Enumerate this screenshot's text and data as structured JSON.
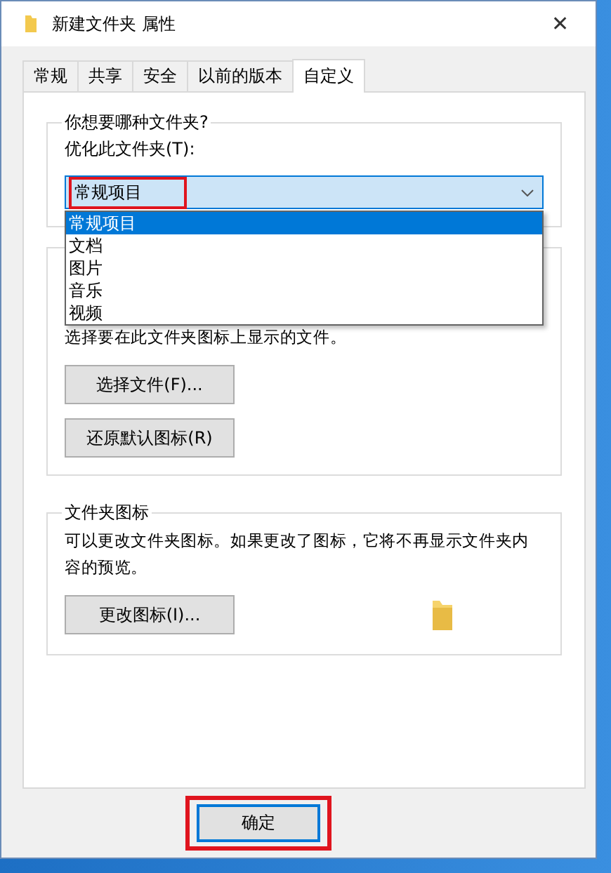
{
  "window": {
    "title": "新建文件夹 属性",
    "close": "✕"
  },
  "tabs": [
    {
      "label": "常规",
      "selected": false
    },
    {
      "label": "共享",
      "selected": false
    },
    {
      "label": "安全",
      "selected": false
    },
    {
      "label": "以前的版本",
      "selected": false
    },
    {
      "label": "自定义",
      "selected": true
    }
  ],
  "folder_type": {
    "title": "你想要哪种文件夹?",
    "label": "优化此文件夹(T):",
    "value": "常规项目",
    "highlighted": true,
    "expanded": true,
    "options": [
      {
        "label": "常规项目",
        "selected": true
      },
      {
        "label": "文档",
        "selected": false
      },
      {
        "label": "图片",
        "selected": false
      },
      {
        "label": "音乐",
        "selected": false
      },
      {
        "label": "视频",
        "selected": false
      }
    ]
  },
  "folder_pictures": {
    "description": "选择要在此文件夹图标上显示的文件。",
    "buttons": [
      "选择文件(F)...",
      "还原默认图标(R)"
    ]
  },
  "folder_icons": {
    "title": "文件夹图标",
    "description": "可以更改文件夹图标。如果更改了图标，它将不再显示文件夹内容的预览。",
    "button": "更改图标(I)..."
  },
  "footer": {
    "ok_button": {
      "label": "确定",
      "highlighted": true
    }
  }
}
